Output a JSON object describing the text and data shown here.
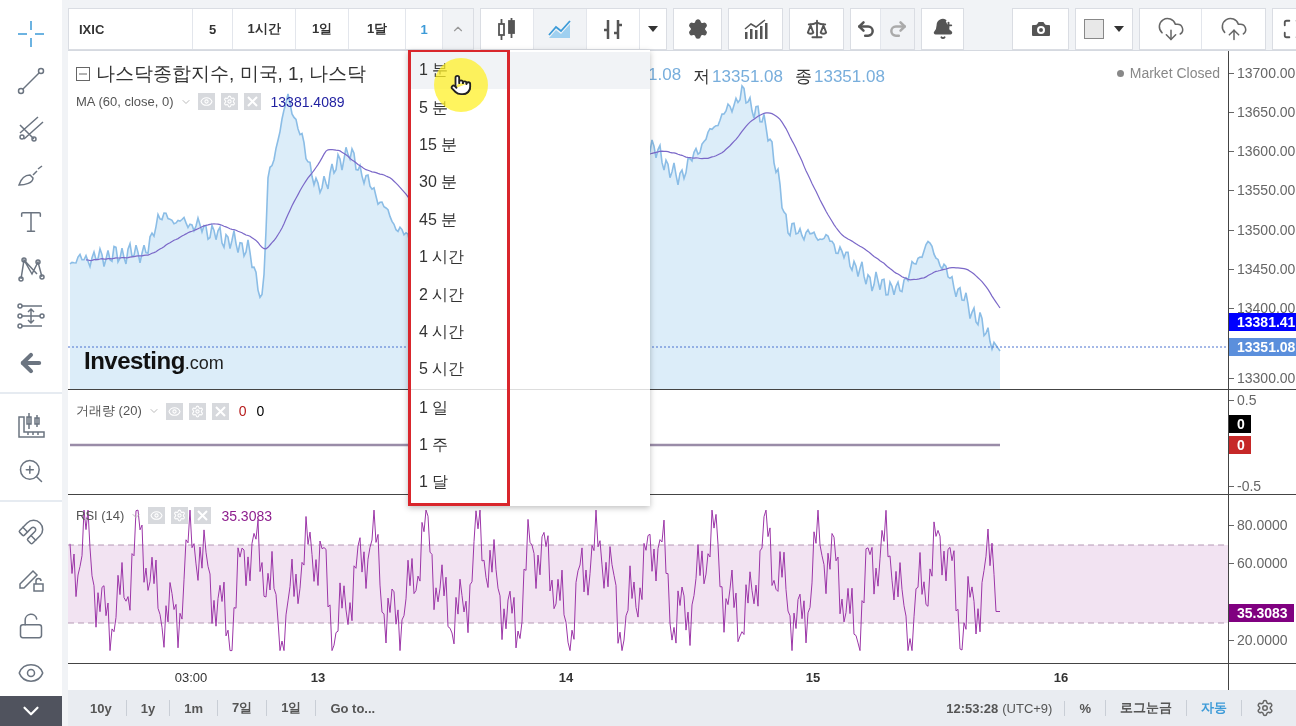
{
  "toolbar": {
    "symbol": "IXIC",
    "intervals": [
      {
        "label": "5",
        "selected": false
      },
      {
        "label": "1시간",
        "selected": false
      },
      {
        "label": "1일",
        "selected": false
      },
      {
        "label": "1달",
        "selected": false
      },
      {
        "label": "1",
        "selected": true
      }
    ],
    "chart_styles": [
      {
        "kind": "candles",
        "selected": false
      },
      {
        "kind": "line",
        "selected": true
      },
      {
        "kind": "bars",
        "selected": false
      }
    ],
    "redo_disabled": true
  },
  "left_tools": [
    {
      "kind": "crosshair",
      "selected": true
    },
    {
      "kind": "line",
      "selected": false
    },
    {
      "kind": "pitchfork",
      "selected": false
    },
    {
      "kind": "brush",
      "selected": false
    },
    {
      "kind": "text",
      "selected": false
    },
    {
      "kind": "pattern",
      "selected": false
    },
    {
      "kind": "measure",
      "selected": false
    },
    {
      "kind": "hide",
      "selected": false
    },
    {
      "kind": "ruler",
      "selected": false
    },
    {
      "kind": "zoom",
      "selected": false
    },
    {
      "kind": "magnet",
      "selected": false
    },
    {
      "kind": "lock-drawings",
      "selected": false
    },
    {
      "kind": "lock",
      "selected": false
    },
    {
      "kind": "eye",
      "selected": false
    }
  ],
  "legend": {
    "title": "나스닥종합지수, 미국, 1, 나스닥",
    "ohlc": [
      {
        "value": "1.08"
      },
      {
        "label": "저",
        "value": "13351.08"
      },
      {
        "label": "종",
        "value": "13351.08"
      }
    ],
    "status": "Market Closed"
  },
  "logo": {
    "brand": "Investing",
    "suffix": ".com"
  },
  "studies": [
    {
      "name": "MA (60, close, 0)",
      "values": [
        {
          "text": "13381.4089",
          "color": "#1f1fa0"
        }
      ]
    },
    {
      "name": "거래량 (20)",
      "values": [
        {
          "text": "0",
          "color": "#b71c1c"
        },
        {
          "text": "0",
          "color": "#000000"
        }
      ]
    },
    {
      "name": "RSI (14)",
      "values": [
        {
          "text": "35.3083",
          "color": "#8e1f8e"
        }
      ]
    }
  ],
  "price_axis": {
    "ticks": [
      "13700.00",
      "13650.00",
      "13600.00",
      "13550.00",
      "13500.00",
      "13450.00",
      "13400.00",
      "13300.00"
    ],
    "tags": [
      {
        "text": "13381.41",
        "color": "#0000ff"
      },
      {
        "text": "13351.08",
        "color": "#5b8fdc"
      }
    ]
  },
  "volume_axis": {
    "ticks": [
      "0.5",
      "-0.5"
    ],
    "tags": [
      {
        "text": "0",
        "color": "#000000"
      },
      {
        "text": "0",
        "color": "#c62828"
      }
    ]
  },
  "rsi_axis": {
    "ticks": [
      "80.0000",
      "60.0000",
      "20.0000"
    ],
    "tags": [
      {
        "text": "35.3083",
        "color": "#800080"
      }
    ]
  },
  "time_axis": [
    {
      "label": "03:00",
      "major": false
    },
    {
      "label": "13",
      "major": true
    },
    {
      "label": "14",
      "major": true
    },
    {
      "label": "15",
      "major": true
    },
    {
      "label": "16",
      "major": true
    }
  ],
  "interval_menu": {
    "groups": [
      [
        {
          "label": "1 분",
          "selected": true
        },
        {
          "label": "5 분",
          "selected": false
        },
        {
          "label": "15 분",
          "selected": false
        },
        {
          "label": "30 분",
          "selected": false
        },
        {
          "label": "45 분",
          "selected": false
        },
        {
          "label": "1 시간",
          "selected": false
        },
        {
          "label": "2 시간",
          "selected": false
        },
        {
          "label": "4 시간",
          "selected": false
        },
        {
          "label": "5 시간",
          "selected": false
        }
      ],
      [
        {
          "label": "1 일",
          "selected": false
        },
        {
          "label": "1 주",
          "selected": false
        },
        {
          "label": "1 달",
          "selected": false
        }
      ]
    ]
  },
  "bottom_bar": {
    "ranges": [
      "10y",
      "1y",
      "1m",
      "7일",
      "1일"
    ],
    "goto": "Go to...",
    "time": "12:53:28",
    "timezone": "(UTC+9)",
    "options": [
      {
        "label": "%",
        "selected": false
      },
      {
        "label": "로그눈금",
        "selected": false
      },
      {
        "label": "자동",
        "selected": true
      }
    ]
  }
}
